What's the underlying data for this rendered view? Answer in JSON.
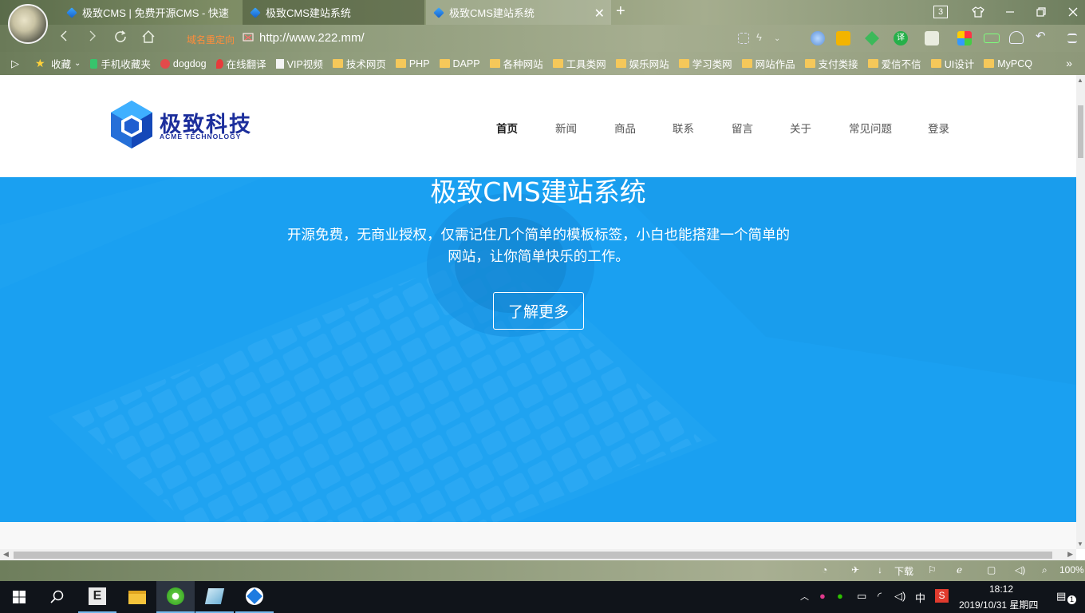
{
  "browser": {
    "tabs": [
      {
        "label": "极致CMS | 免费开源CMS - 快速"
      },
      {
        "label": "极致CMS建站系统"
      },
      {
        "label": "极致CMS建站系统"
      }
    ],
    "tab_count": "3",
    "redirect_label": "域名重定向",
    "url": "http://www.222.mm/",
    "bookmarks": [
      {
        "label": "收藏",
        "icon": "star-icon"
      },
      {
        "label": "手机收藏夹",
        "icon": "phone-icon"
      },
      {
        "label": "dogdog",
        "icon": "dog-icon"
      },
      {
        "label": "在线翻译",
        "icon": "flame-icon"
      },
      {
        "label": "VIP视频",
        "icon": "page-icon"
      },
      {
        "label": "技术网页",
        "icon": "folder-icon"
      },
      {
        "label": "PHP",
        "icon": "folder-icon"
      },
      {
        "label": "DAPP",
        "icon": "folder-icon"
      },
      {
        "label": "各种网站",
        "icon": "folder-icon"
      },
      {
        "label": "工具类网",
        "icon": "folder-icon"
      },
      {
        "label": "娱乐网站",
        "icon": "folder-icon"
      },
      {
        "label": "学习类网",
        "icon": "folder-icon"
      },
      {
        "label": "网站作品",
        "icon": "folder-icon"
      },
      {
        "label": "支付类接",
        "icon": "folder-icon"
      },
      {
        "label": "爱信不信",
        "icon": "folder-icon"
      },
      {
        "label": "UI设计",
        "icon": "folder-icon"
      },
      {
        "label": "MyPCQ",
        "icon": "folder-icon"
      }
    ],
    "more_bookmarks": "»"
  },
  "site": {
    "logo_cn": "极致科技",
    "logo_en": "ACME TECHNOLOGY",
    "nav": [
      "首页",
      "新闻",
      "商品",
      "联系",
      "留言",
      "关于",
      "常见问题",
      "登录"
    ],
    "hero_title": "极致CMS建站系统",
    "hero_desc": "开源免费，无商业授权，仅需记住几个简单的模板标签，小白也能搭建一个简单的网站，让你简单快乐的工作。",
    "hero_button": "了解更多",
    "hero_color": "#1ba0f1"
  },
  "statusbar": {
    "download": "下载",
    "zoom": "100%"
  },
  "taskbar": {
    "time": "18:12",
    "date": "2019/10/31 星期四",
    "ime": "中",
    "notifications": "1"
  }
}
